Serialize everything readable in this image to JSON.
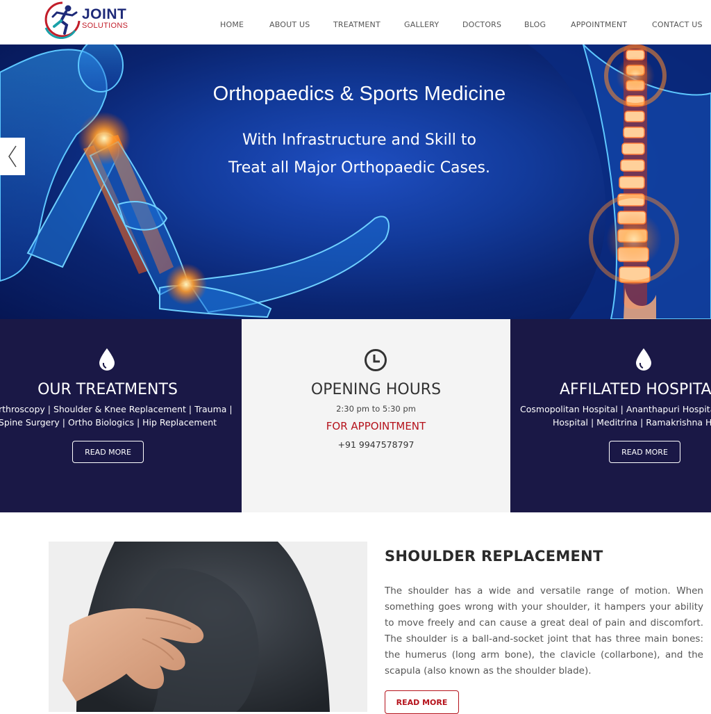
{
  "brand": {
    "name_line1": "JOINT",
    "name_line2": "SOLUTIONS",
    "colors": {
      "navy": "#1e2a78",
      "red": "#c21e2a",
      "teal": "#1aa0a8"
    }
  },
  "nav": {
    "items": [
      "HOME",
      "ABOUT US",
      "TREATMENT",
      "GALLERY",
      "DOCTORS",
      "BLOG",
      "APPOINTMENT",
      "CONTACT US"
    ]
  },
  "hero": {
    "title": "Orthopaedics & Sports Medicine",
    "subtitle_line1": "With Infrastructure and Skill to",
    "subtitle_line2": "Treat all Major Orthopaedic Cases.",
    "prev_icon": "chevron-left-icon"
  },
  "panels": {
    "treatments": {
      "icon": "drop-icon",
      "title": "OUR TREATMENTS",
      "line1": "Arthroscopy | Shoulder & Knee Replacement | Trauma |",
      "line2": "Spine Surgery | Ortho Biologics | Hip Replacement",
      "button": "READ MORE"
    },
    "hours": {
      "icon": "clock-icon",
      "title": "OPENING HOURS",
      "time": "2:30 pm to 5:30 pm",
      "appointment_label": "FOR APPOINTMENT",
      "phone": "+91 9947578797"
    },
    "hospitals": {
      "icon": "drop-icon",
      "title": "AFFILATED HOSPITALS",
      "line1": "Cosmopolitan Hospital | Ananthapuri Hospital |",
      "line2": "Hospital | Meditrina | Ramakrishna Hospital",
      "button": "READ MORE"
    },
    "colors": {
      "dark": "#1a1846",
      "light": "#f4f4f4",
      "accent_red": "#b5121b"
    }
  },
  "shoulder": {
    "title": "SHOULDER REPLACEMENT",
    "lines": [
      "The shoulder has a wide and versatile range of motion. When",
      "something goes wrong with your shoulder, it hampers your ability",
      "to move freely and can cause a great deal of pain and discomfort.",
      "The shoulder is a ball-and-socket joint that has three main bones:",
      "the humerus (long arm bone), the clavicle (collarbone), and the",
      "scapula (also known as the shoulder blade)."
    ],
    "button": "READ MORE"
  }
}
